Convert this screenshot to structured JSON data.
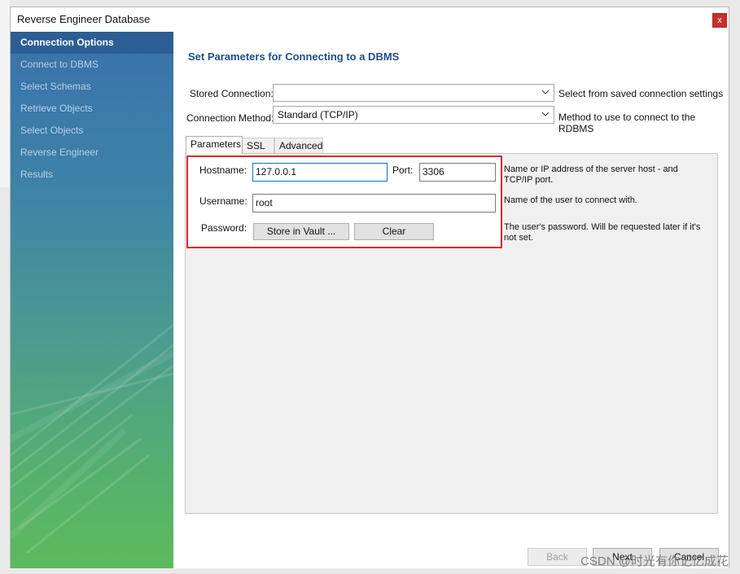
{
  "window": {
    "title": "Reverse Engineer Database",
    "close_glyph": "x"
  },
  "sidebar": {
    "items": [
      {
        "label": "Connection Options",
        "active": true
      },
      {
        "label": "Connect to DBMS",
        "active": false
      },
      {
        "label": "Select Schemas",
        "active": false
      },
      {
        "label": "Retrieve Objects",
        "active": false
      },
      {
        "label": "Select Objects",
        "active": false
      },
      {
        "label": "Reverse Engineer",
        "active": false
      },
      {
        "label": "Results",
        "active": false
      }
    ]
  },
  "main": {
    "heading": "Set Parameters for Connecting to a DBMS",
    "stored_connection": {
      "label": "Stored Connection:",
      "value": "",
      "hint": "Select from saved connection settings"
    },
    "connection_method": {
      "label": "Connection Method:",
      "value": "Standard (TCP/IP)",
      "hint": "Method to use to connect to the RDBMS"
    },
    "tabs": [
      {
        "label": "Parameters",
        "active": true
      },
      {
        "label": "SSL",
        "active": false
      },
      {
        "label": "Advanced",
        "active": false
      }
    ],
    "parameters": {
      "hostname_label": "Hostname:",
      "hostname_value": "127.0.0.1",
      "port_label": "Port:",
      "port_value": "3306",
      "hostname_hint": "Name or IP address of the server host - and TCP/IP port.",
      "username_label": "Username:",
      "username_value": "root",
      "username_hint": "Name of the user to connect with.",
      "password_label": "Password:",
      "store_vault_label": "Store in Vault ...",
      "clear_label": "Clear",
      "password_hint": "The user's password. Will be requested later if it's not set."
    }
  },
  "footer": {
    "back_label": "Back",
    "next_label": "Next",
    "cancel_label": "Cancel"
  },
  "watermark": "CSDN @时光有你记忆成花",
  "colors": {
    "accent": "#1f4e8c",
    "highlight_border": "#e0262b",
    "sidebar_top": "#3a72ab",
    "sidebar_bottom": "#5cba5d",
    "close_button": "#c9302c"
  }
}
